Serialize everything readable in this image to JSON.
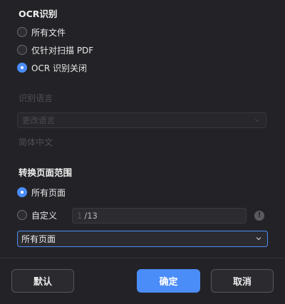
{
  "ocr": {
    "title": "OCR识别",
    "options": [
      {
        "label": "所有文件",
        "checked": false
      },
      {
        "label": "仅针对扫描 PDF",
        "checked": false
      },
      {
        "label": "OCR 识别关闭",
        "checked": true
      }
    ],
    "language_label": "识别语言",
    "language_select_value": "更改语言",
    "language_current": "简体中文"
  },
  "page_range": {
    "title": "转换页面范围",
    "options": [
      {
        "label": "所有页面",
        "checked": true
      },
      {
        "label": "自定义",
        "checked": false
      }
    ],
    "custom_input_placeholder": "1",
    "custom_input_total": "/13",
    "select_value": "所有页面"
  },
  "footer": {
    "default_label": "默认",
    "ok_label": "确定",
    "cancel_label": "取消"
  },
  "colors": {
    "accent": "#4b8df8",
    "background": "#232327"
  }
}
